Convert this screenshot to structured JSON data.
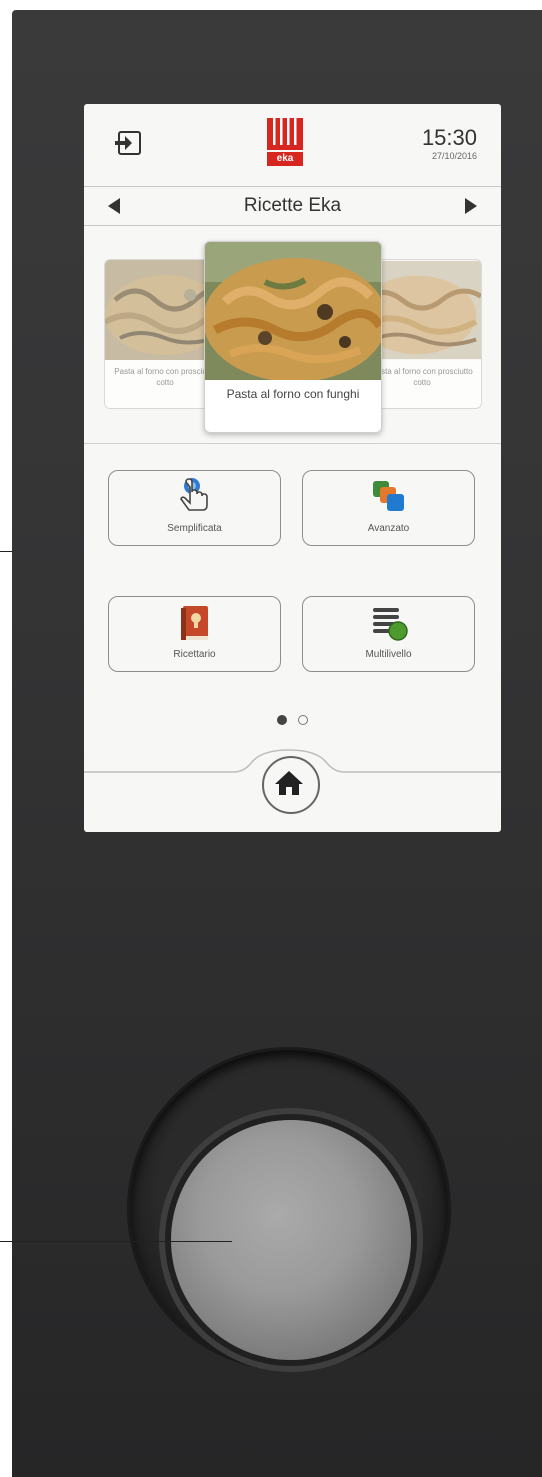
{
  "header": {
    "exit_icon": "exit-icon",
    "logo_text": "eka",
    "time": "15:30",
    "date": "27/10/2016"
  },
  "titlebar": {
    "title": "Ricette Eka",
    "prev_icon": "triangle-left-icon",
    "next_icon": "triangle-right-icon"
  },
  "carousel": {
    "left_caption": "Pasta al forno con prosciutto cotto",
    "center_caption": "Pasta al forno con funghi",
    "right_caption": "Pasta al forno con prosciutto cotto"
  },
  "tiles": [
    {
      "label": "Semplificata",
      "icon": "hand-tap-icon"
    },
    {
      "label": "Avanzato",
      "icon": "stacked-squares-icon"
    },
    {
      "label": "Ricettario",
      "icon": "recipe-book-icon"
    },
    {
      "label": "Multilivello",
      "icon": "multilevel-icon"
    }
  ],
  "pager": {
    "pages": 2,
    "current": 1
  },
  "home_icon": "home-icon",
  "colors": {
    "brand_red": "#d7261f",
    "panel": "#353536",
    "screen": "#f7f7f5",
    "tile_border": "#8d8d8d",
    "knob": "#9a9a9a"
  }
}
